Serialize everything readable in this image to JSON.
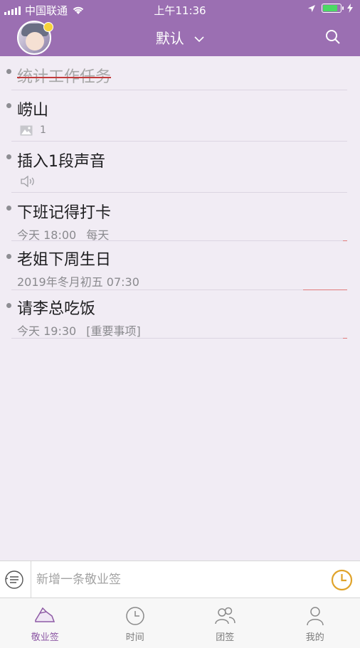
{
  "status": {
    "carrier": "中国联通",
    "time": "上午11:36"
  },
  "header": {
    "title": "默认"
  },
  "tasks": [
    {
      "title": "统计工作任务",
      "done": true,
      "meta": []
    },
    {
      "title": "崂山",
      "done": false,
      "meta": [],
      "image_count": "1"
    },
    {
      "title": "插入1段声音",
      "done": false,
      "meta": [],
      "audio": true
    },
    {
      "title": " 下班记得打卡",
      "done": false,
      "meta": [
        "今天 18:00",
        "每天"
      ]
    },
    {
      "title": "老姐下周生日",
      "done": false,
      "meta": [
        "2019年冬月初五 07:30"
      ]
    },
    {
      "title": "请李总吃饭",
      "done": false,
      "meta": [
        "今天 19:30",
        "[重要事项]"
      ]
    }
  ],
  "input": {
    "placeholder": "新增一条敬业签"
  },
  "tabs": [
    {
      "label": "敬业签",
      "icon": "note-icon",
      "active": true
    },
    {
      "label": "时间",
      "icon": "clock-icon",
      "active": false
    },
    {
      "label": "团签",
      "icon": "team-icon",
      "active": false
    },
    {
      "label": "我的",
      "icon": "user-icon",
      "active": false
    }
  ],
  "colors": {
    "accent": "#9b6fb2",
    "tab_active": "#8e5aa5",
    "clock": "#e0a32a",
    "strike": "#c23b3b"
  }
}
